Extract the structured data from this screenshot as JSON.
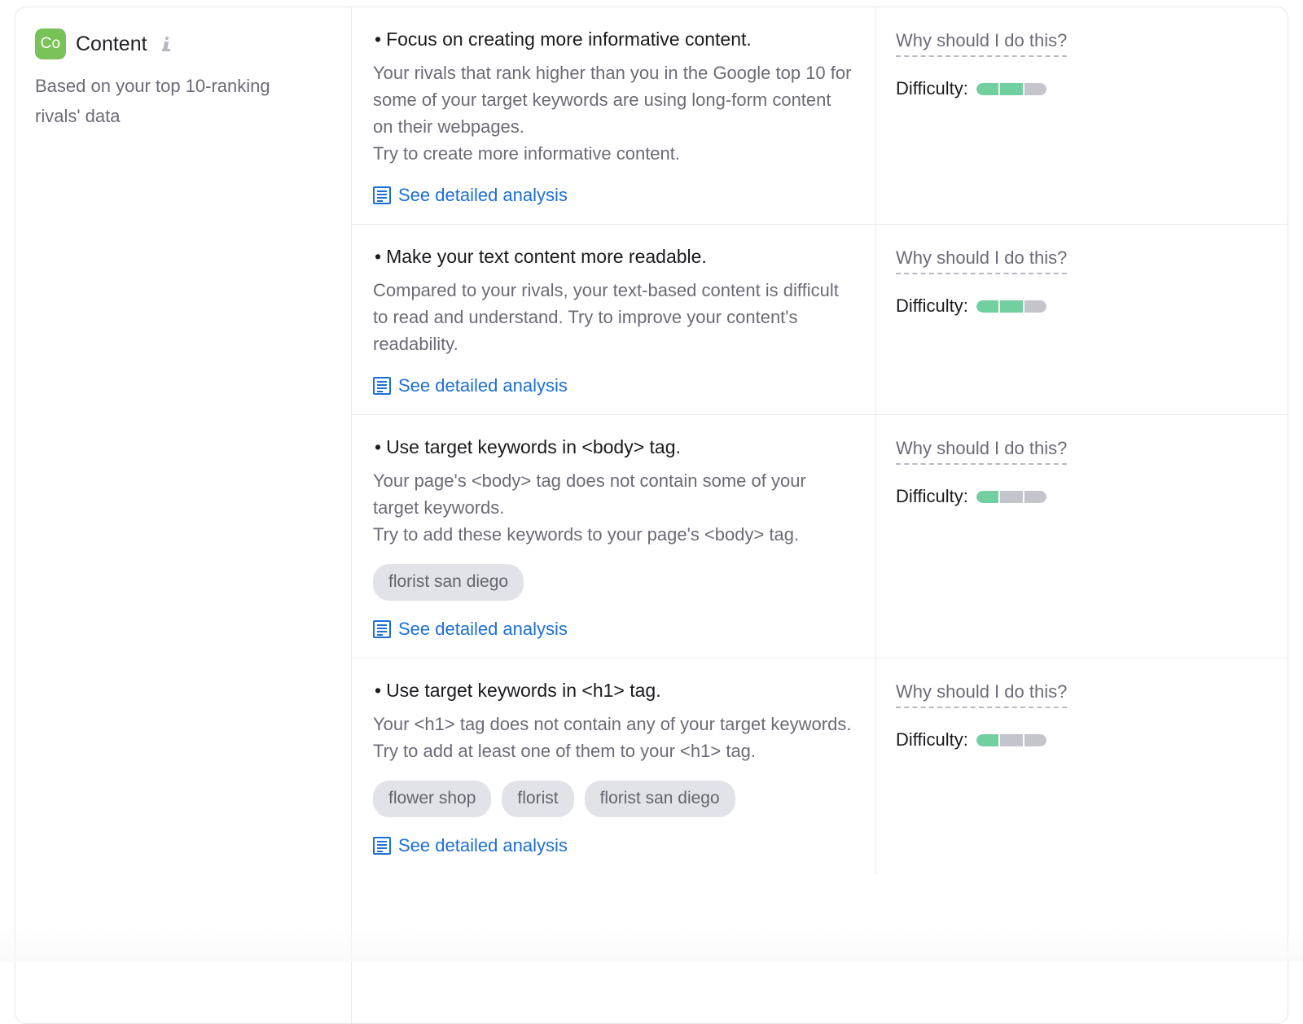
{
  "category": {
    "badge_text": "Co",
    "badge_color": "#79c257",
    "title": "Content",
    "info_icon": "info-icon",
    "subtitle": "Based on your top 10-ranking rivals' data"
  },
  "labels": {
    "why_link": "Why should I do this?",
    "difficulty_label": "Difficulty:",
    "analysis_link": "See detailed analysis",
    "bullet": "•"
  },
  "colors": {
    "accent_link": "#1c6fd6",
    "meter_on": "#72d0a0",
    "meter_off": "#c3c4cc",
    "pill_bg": "#e2e3e8",
    "border": "#eaeaef"
  },
  "recommendations": [
    {
      "title": "Focus on creating more informative content.",
      "description": "Your rivals that rank higher than you in the Google top 10 for some of your target keywords are using long-form content on their webpages.\nTry to create more informative content.",
      "keywords": [],
      "analysis_link": "See detailed analysis",
      "why_link": "Why should I do this?",
      "difficulty_label": "Difficulty:",
      "difficulty_filled": 2,
      "difficulty_total": 3
    },
    {
      "title": "Make your text content more readable.",
      "description": "Compared to your rivals, your text-based content is difficult to read and understand. Try to improve your content's readability.",
      "keywords": [],
      "analysis_link": "See detailed analysis",
      "why_link": "Why should I do this?",
      "difficulty_label": "Difficulty:",
      "difficulty_filled": 2,
      "difficulty_total": 3
    },
    {
      "title": "Use target keywords in <body> tag.",
      "description": "Your page's <body> tag does not contain some of your target keywords.\nTry to add these keywords to your page's <body> tag.",
      "keywords": [
        "florist san diego"
      ],
      "analysis_link": "See detailed analysis",
      "why_link": "Why should I do this?",
      "difficulty_label": "Difficulty:",
      "difficulty_filled": 1,
      "difficulty_total": 3
    },
    {
      "title": "Use target keywords in <h1> tag.",
      "description": "Your <h1> tag does not contain any of your target keywords.\nTry to add at least one of them to your <h1> tag.",
      "keywords": [
        "flower shop",
        "florist",
        "florist san diego"
      ],
      "analysis_link": "See detailed analysis",
      "why_link": "Why should I do this?",
      "difficulty_label": "Difficulty:",
      "difficulty_filled": 1,
      "difficulty_total": 3
    }
  ]
}
